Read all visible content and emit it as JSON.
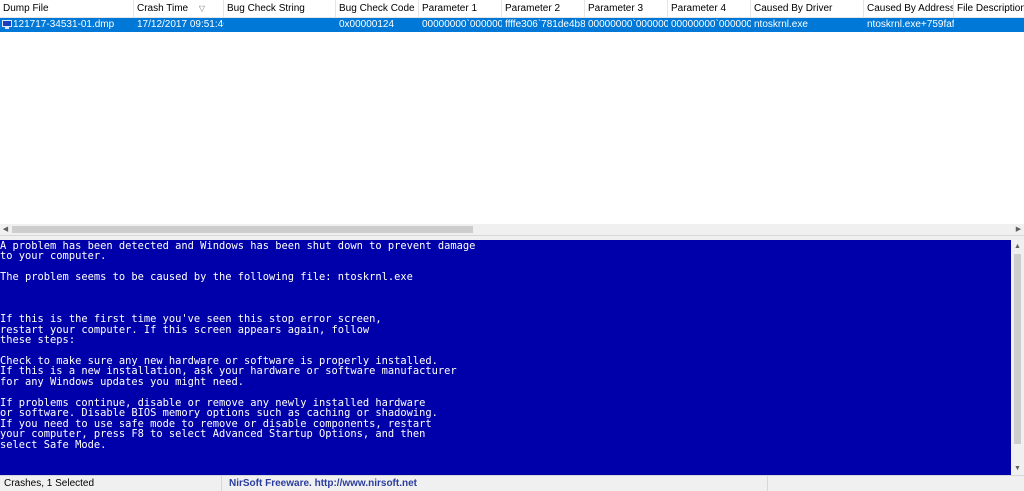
{
  "list": {
    "columns": [
      {
        "key": "dump_file",
        "label": "Dump File"
      },
      {
        "key": "crash_time",
        "label": "Crash Time"
      },
      {
        "key": "bug_check_string",
        "label": "Bug Check String"
      },
      {
        "key": "bug_check_code",
        "label": "Bug Check Code"
      },
      {
        "key": "parameter_1",
        "label": "Parameter 1"
      },
      {
        "key": "parameter_2",
        "label": "Parameter 2"
      },
      {
        "key": "parameter_3",
        "label": "Parameter 3"
      },
      {
        "key": "parameter_4",
        "label": "Parameter 4"
      },
      {
        "key": "caused_by_driver",
        "label": "Caused By Driver"
      },
      {
        "key": "caused_by_address",
        "label": "Caused By Address"
      },
      {
        "key": "file_description",
        "label": "File Description"
      }
    ],
    "sorted_column": "Crash Time",
    "sort_indicator_icon": "sort-descending-icon",
    "rows": [
      {
        "selected": true,
        "icon": "crash-dump-icon",
        "dump_file": "121717-34531-01.dmp",
        "crash_time": "17/12/2017 09:51:46",
        "bug_check_string": "",
        "bug_check_code": "0x00000124",
        "parameter_1": "00000000`000000...",
        "parameter_2": "ffffe306`781de4b8",
        "parameter_3": "00000000`000000...",
        "parameter_4": "00000000`000000...",
        "caused_by_driver": "ntoskrnl.exe",
        "caused_by_address": "ntoskrnl.exe+759faf",
        "file_description": ""
      }
    ]
  },
  "bsod": {
    "background_color": "#0000aa",
    "text_color": "#ffffff",
    "lines": [
      "A problem has been detected and Windows has been shut down to prevent damage",
      "to your computer.",
      "",
      "The problem seems to be caused by the following file: ntoskrnl.exe",
      "",
      "",
      "",
      "If this is the first time you've seen this stop error screen,",
      "restart your computer. If this screen appears again, follow",
      "these steps:",
      "",
      "Check to make sure any new hardware or software is properly installed.",
      "If this is a new installation, ask your hardware or software manufacturer",
      "for any Windows updates you might need.",
      "",
      "If problems continue, disable or remove any newly installed hardware",
      "or software. Disable BIOS memory options such as caching or shadowing.",
      "If you need to use safe mode to remove or disable components, restart",
      "your computer, press F8 to select Advanced Startup Options, and then",
      "select Safe Mode."
    ]
  },
  "statusbar": {
    "summary": "Crashes, 1 Selected",
    "credit_text": "NirSoft Freeware.",
    "credit_url": "http://www.nirsoft.net"
  },
  "colors": {
    "selection": "#0078d7",
    "bsod_blue": "#0000aa",
    "link": "#2a3d9e"
  }
}
